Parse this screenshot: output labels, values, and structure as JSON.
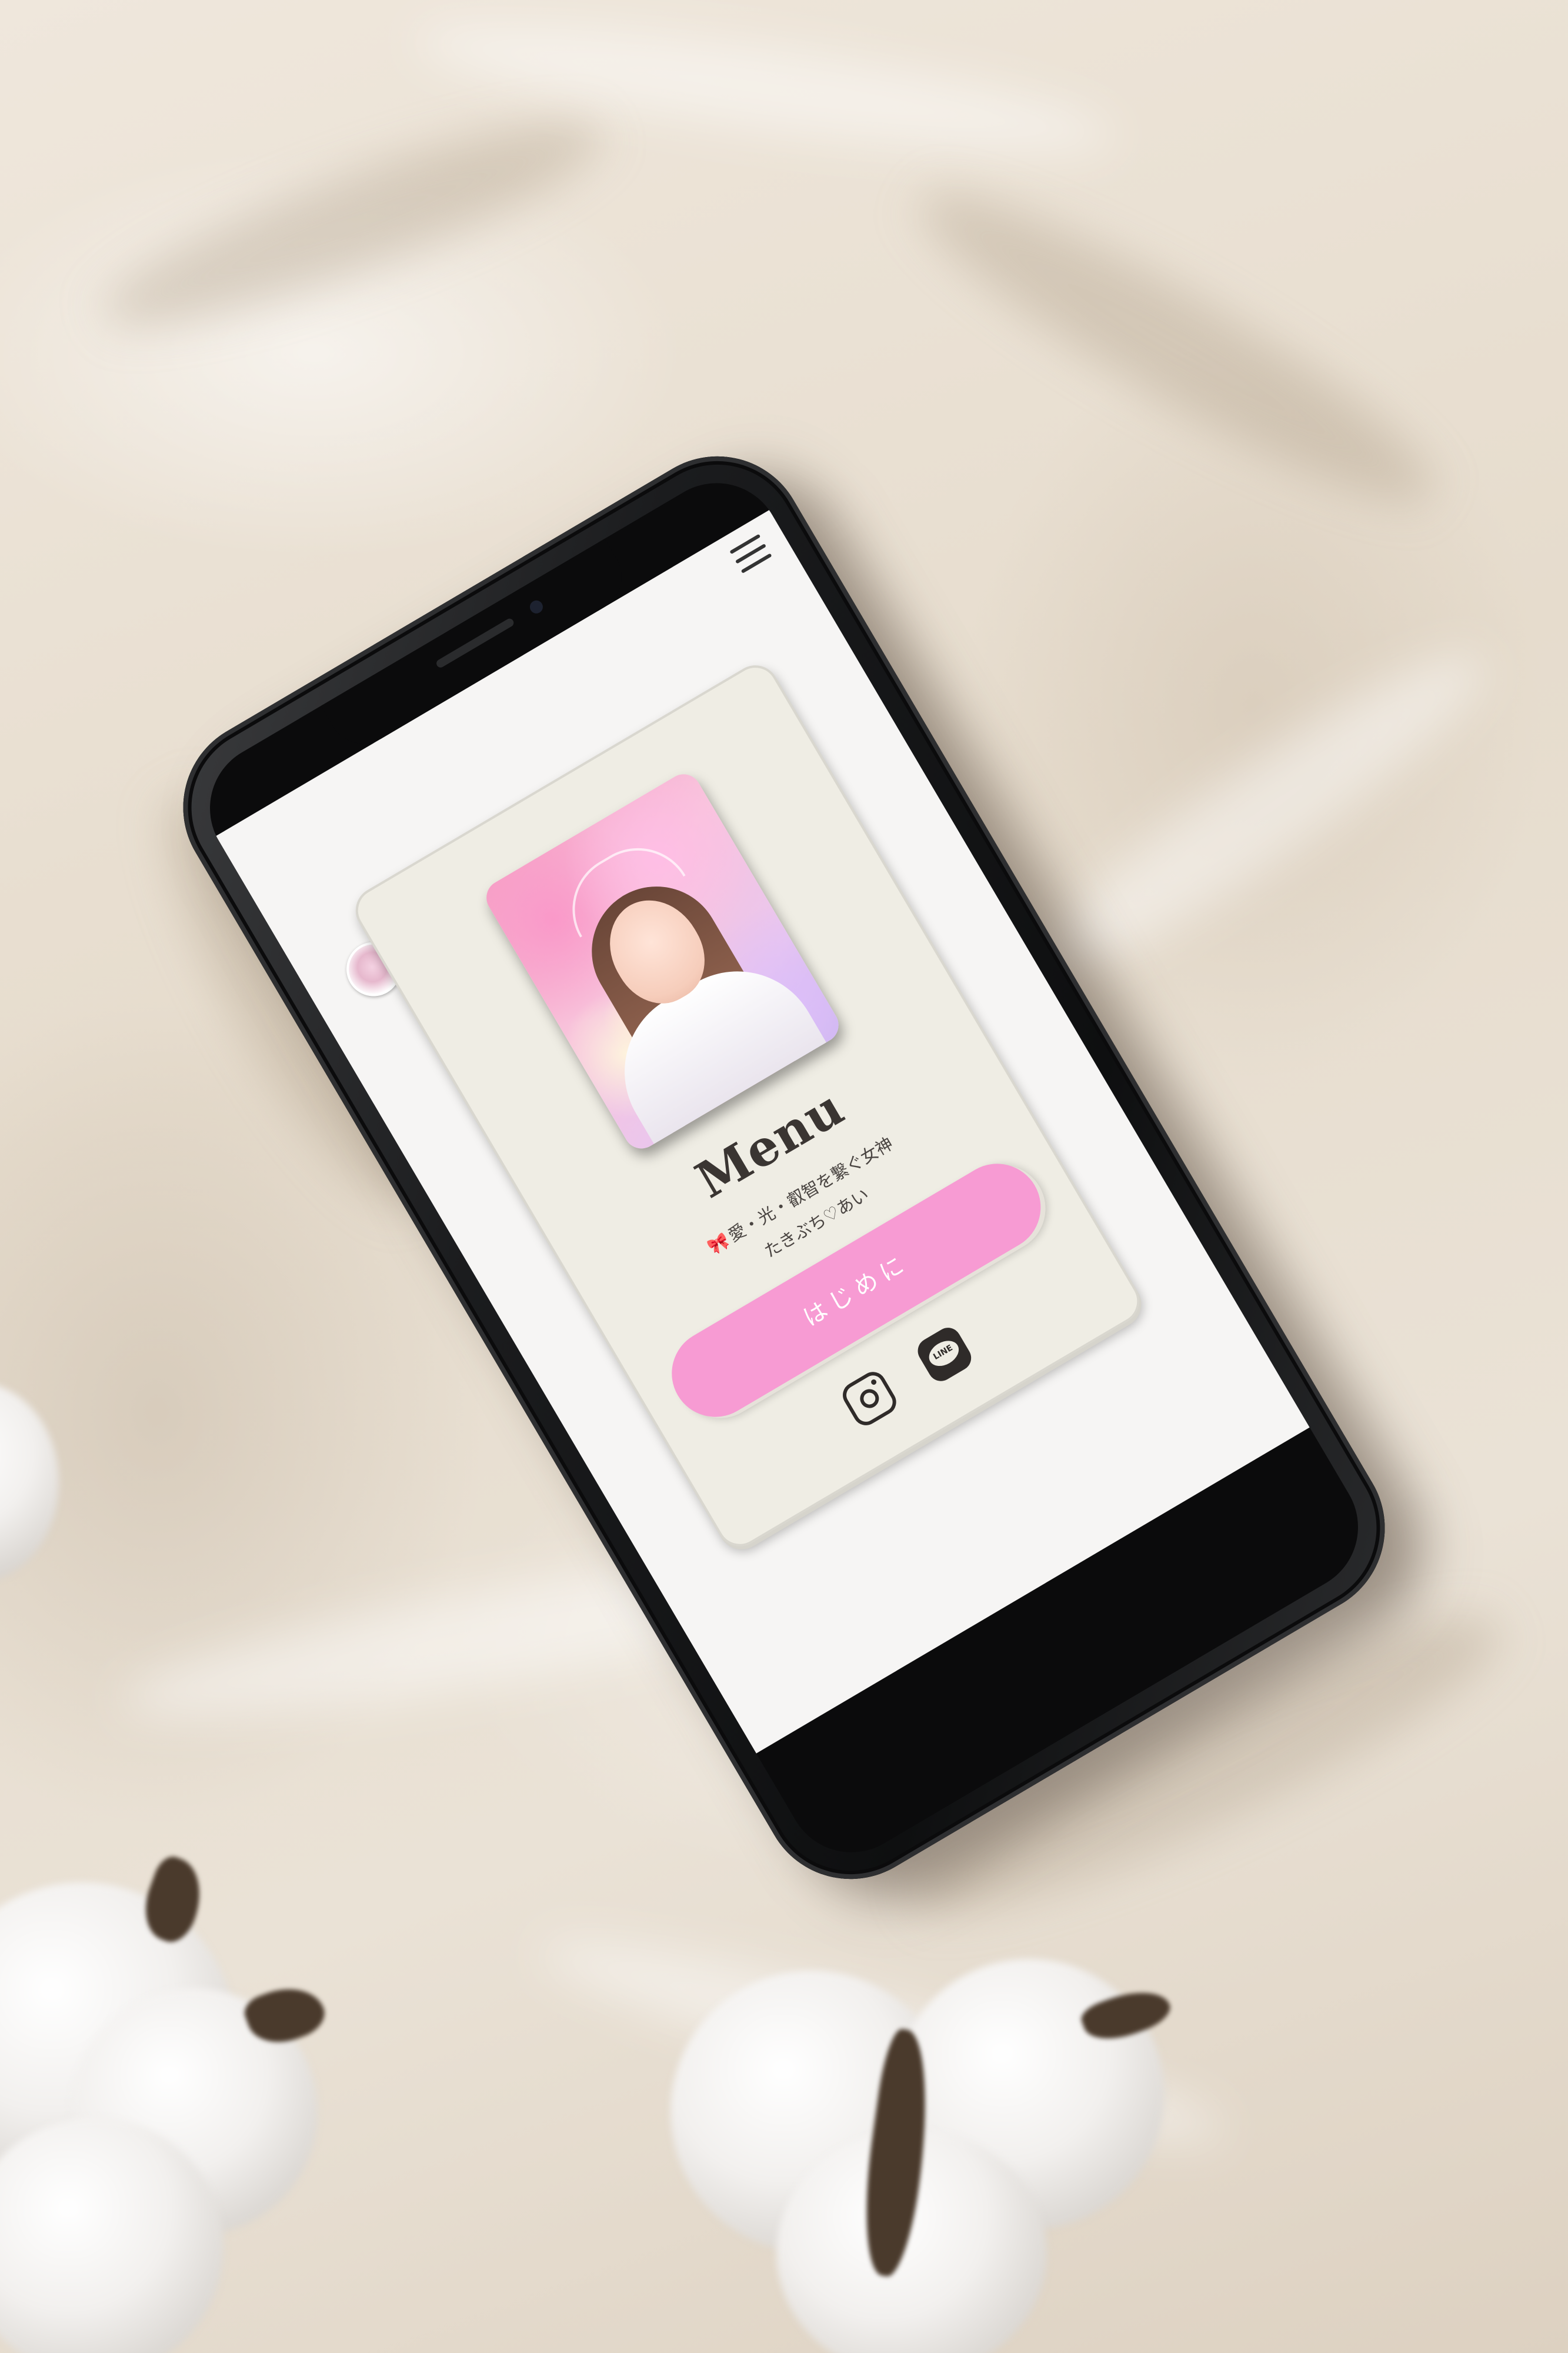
{
  "app": {
    "menu_icon": "hamburger-menu-icon",
    "logo_icon": "brand-logo-circle",
    "title": "Menu",
    "subtitle_bow": "🎀",
    "subtitle_line1": "愛・光・叡智を繋ぐ女神",
    "subtitle_line2": "たきぶち♡あい",
    "cta_label": "はじめに",
    "social": {
      "instagram_icon": "instagram-icon",
      "line_icon": "line-icon",
      "line_text": "LINE"
    }
  },
  "colors": {
    "card_bg": "#efede4",
    "cta_bg": "#f79bd3",
    "cta_text": "#ffffff",
    "title_text": "#3a3532",
    "screen_bg": "#f6f5f4"
  }
}
